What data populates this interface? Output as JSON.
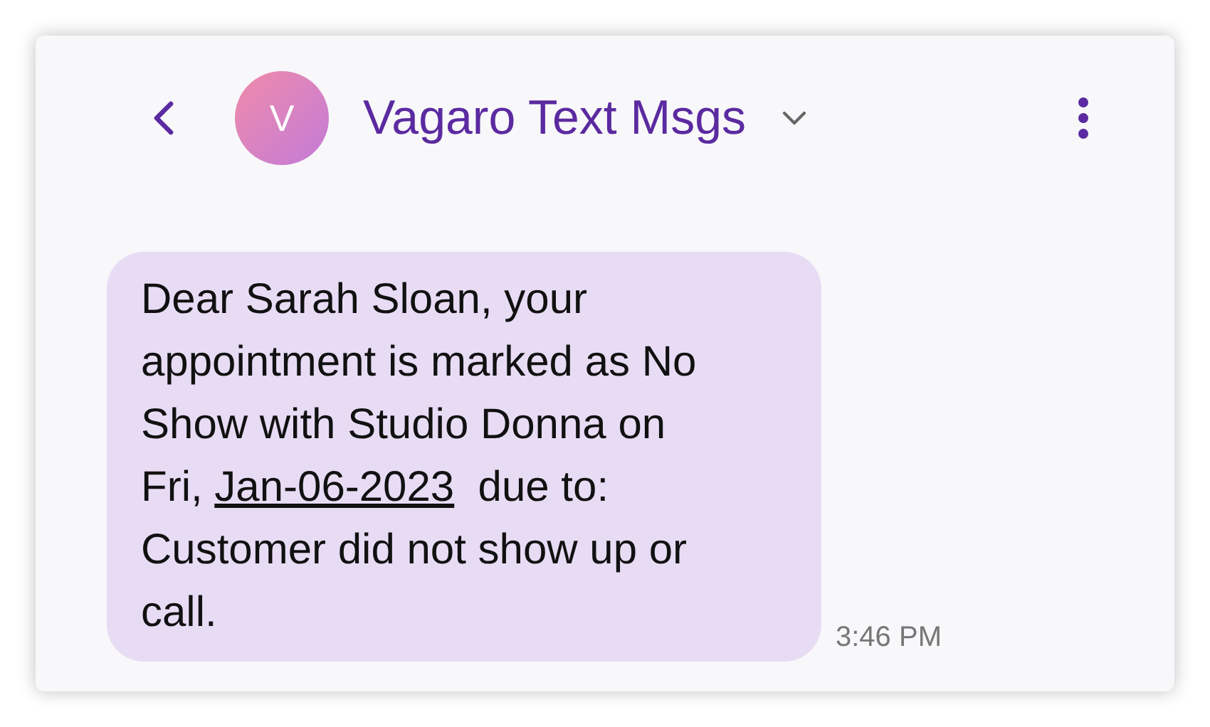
{
  "header": {
    "avatar_letter": "V",
    "title": "Vagaro Text Msgs"
  },
  "message": {
    "text_before": "Dear Sarah Sloan, your appointment is marked as No Show with Studio Donna on Fri, ",
    "link": "Jan-06-2023",
    "text_after": "  due to: Customer did not show up or call.",
    "time": "3:46 PM"
  }
}
